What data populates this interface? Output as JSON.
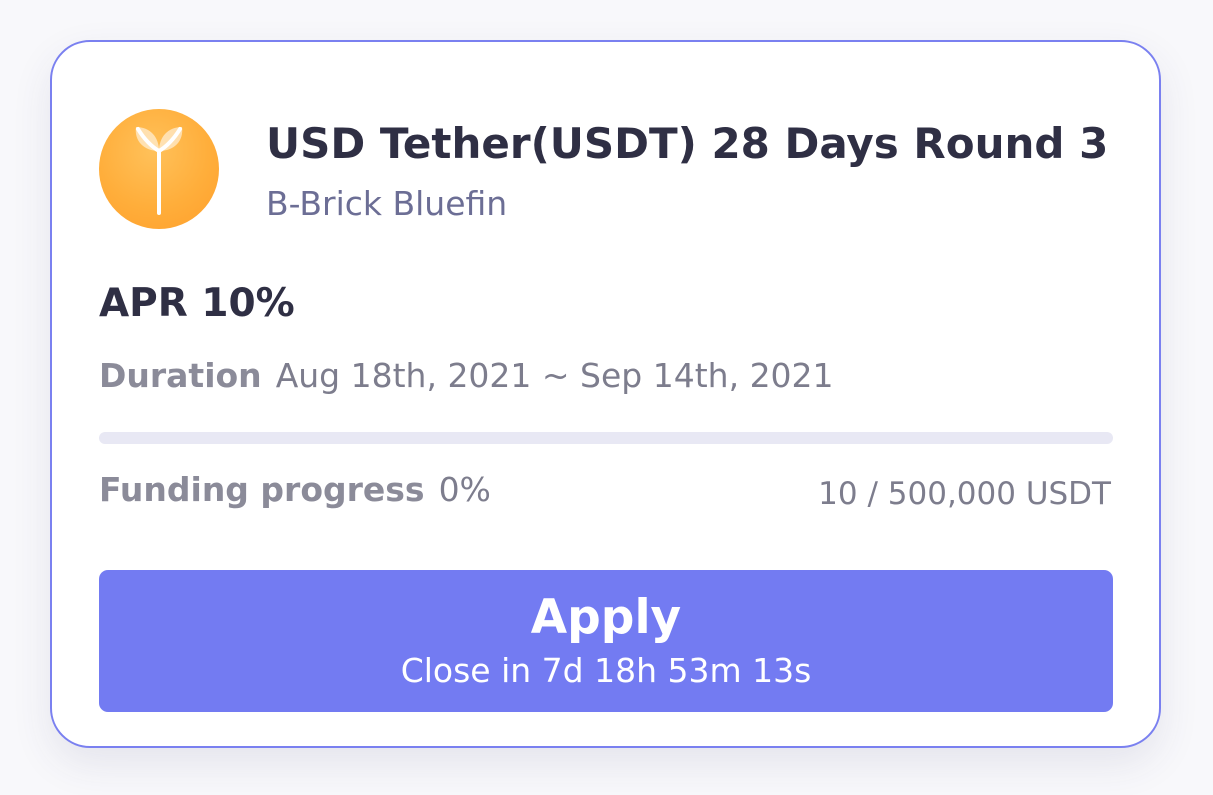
{
  "card": {
    "logo_icon": "sprout-icon",
    "title": "USD Tether(USDT) 28 Days Round 3",
    "subtitle": "B-Brick Bluefin",
    "apr": "APR 10%",
    "duration_label": "Duration",
    "duration_value": "Aug 18th, 2021 ~ Sep 14th, 2021",
    "progress_fraction": 0,
    "funding_label": "Funding progress",
    "funding_value": "0%",
    "amount": "10 / 500,000 USDT",
    "button_label": "Apply",
    "button_sub": "Close in 7d 18h 53m 13s"
  },
  "colors": {
    "accent": "#737bf2",
    "card_border": "#7a80f0",
    "logo": "#ffae3b",
    "title": "#2f2f44",
    "subtitle": "#6c6e95"
  }
}
